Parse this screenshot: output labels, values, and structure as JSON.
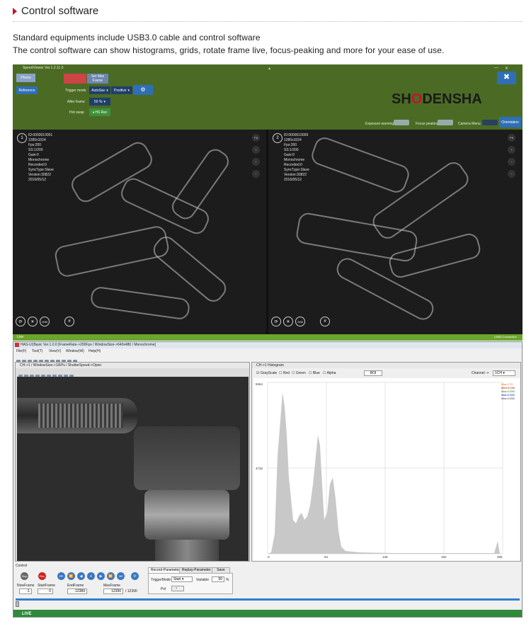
{
  "heading": {
    "title": "Control software"
  },
  "intro": {
    "line1": "Standard equipments include USB3.0 cable and control software",
    "line2": "The control software can show histograms, grids, rotate frame live, focus-peaking and more for your ease of use."
  },
  "speedviewer": {
    "window_title": "SpeedViewer Ver.1.2.11.0",
    "buttons": {
      "phone": "Phone",
      "reference": "Reference",
      "set_max_frame": "Set Max Frame",
      "orientation": "Orientation"
    },
    "trigger_mode_label": "Trigger mode",
    "trigger_mode_value": "AutoSav",
    "trigger_polarity": "Positive",
    "after_frame_label": "After frame",
    "after_frame_value": "50 %",
    "hot_swap_label": "Hot swap",
    "hot_swap_button": "HS Rec",
    "logo": {
      "pre": "SH",
      "o": "O",
      "post": "DENSHA"
    },
    "toggles": {
      "exposure": "Exposure warning",
      "focus": "Focus peaking",
      "camera_menu": "Camera Menu"
    },
    "cam1": {
      "num": "1",
      "info": [
        "ID:0000010051",
        "1280x1024",
        "Fps:200",
        "SS:1/200",
        "Gain:0",
        "Monochrome",
        "Recorded:0",
        "SyncType:Slave",
        "Version:30822",
        "2016/05/12"
      ],
      "fit": "Fit",
      "gm": "G/M"
    },
    "cam2": {
      "num": "2",
      "info": [
        "ID:0000010009",
        "1280x1024",
        "Fps:200",
        "SS:1/200",
        "Gain:0",
        "Monochrome",
        "Recorded:0",
        "SyncType:Slave",
        "Version:30822",
        "2016/05/12"
      ],
      "fit": "Fit",
      "gm": "G/M"
    },
    "status_left": "Live",
    "status_right": "USB3 Connection"
  },
  "has": {
    "title": "HAS-U1Basic Ver.1.0.0   [FrameRate->200Fps / WindowSize->640x480 / Monochrome]",
    "menu": [
      "File(F)",
      "Tool(T)",
      "View(V)",
      "Window(W)",
      "Help(H)"
    ],
    "live_title": "CH->1 / WindowSize->100% / ShutterSpeed->Open",
    "hist_title": "CH->1 Histogram",
    "checks": {
      "gray": "GrayScale",
      "red": "Red",
      "green": "Green",
      "blue": "Blue",
      "alpha": "Alpha"
    },
    "roi": "ROI",
    "channel_label": "Channel ->",
    "channel_value": "1CH",
    "stats": [
      "Max:2:72",
      "Med:0:255",
      "Max:0:255",
      "Max:0:255",
      "Max:0:255"
    ],
    "y_top": "9464",
    "y_mid": "4732",
    "x_ticks": [
      "0",
      "64",
      "128",
      "192",
      "255"
    ],
    "control_title": "Control",
    "stop": "Stop",
    "rec": "Rec",
    "now_frame_label": "NowFrame",
    "start_frame_label": "StartFrame",
    "end_frame_label": "EndFrame",
    "max_frame_label": "MaxFrame",
    "now_frame": "-1",
    "start_frame": "0",
    "end_frame": "12389",
    "max_frame": "12390",
    "max_total": "12390",
    "tabs": [
      "Record-Parameter",
      "Replay-Parameter",
      "Save"
    ],
    "trigger_mode_label": "TriggerMode",
    "trigger_mode_value": "Start",
    "variable_label": "Variable",
    "variable_value": "50",
    "variable_unit": "%",
    "pol_label": "Pol",
    "pol_value": "-",
    "status": "LIVE"
  },
  "colors": {
    "accent": "#c8102e",
    "sv_green": "#4b6b24",
    "live_green": "#2f8a3c",
    "hist": "#c8c8c8"
  }
}
